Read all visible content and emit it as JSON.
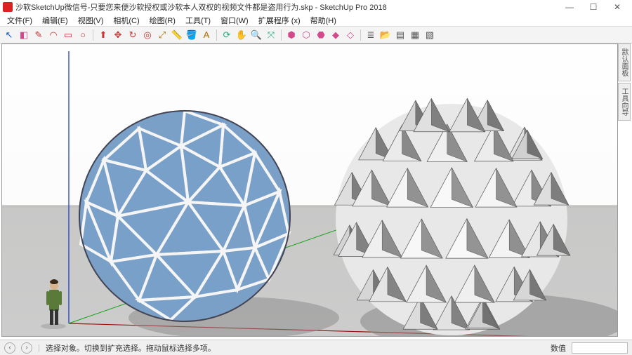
{
  "window": {
    "title": "沙软SketchUp微信号-只要您来便沙软授权或沙软本人双权的视频文件都是盗用行为.skp - SketchUp Pro 2018",
    "min": "—",
    "max": "☐",
    "close": "✕"
  },
  "menu": {
    "items": [
      "文件(F)",
      "编辑(E)",
      "视图(V)",
      "相机(C)",
      "绘图(R)",
      "工具(T)",
      "窗口(W)",
      "扩展程序 (x)",
      "帮助(H)"
    ]
  },
  "toolbar": {
    "icons": [
      {
        "name": "select-arrow-icon",
        "glyph": "↖",
        "color": "#1155cc"
      },
      {
        "name": "eraser-icon",
        "glyph": "◧",
        "color": "#d24a8a"
      },
      {
        "name": "line-icon",
        "glyph": "✎",
        "color": "#c33"
      },
      {
        "name": "arc-icon",
        "glyph": "◠",
        "color": "#c33"
      },
      {
        "name": "rect-icon",
        "glyph": "▭",
        "color": "#c33"
      },
      {
        "name": "circle-icon",
        "glyph": "○",
        "color": "#c33"
      },
      {
        "name": "sep",
        "glyph": "",
        "color": ""
      },
      {
        "name": "pushpull-icon",
        "glyph": "⬆",
        "color": "#c33"
      },
      {
        "name": "move-icon",
        "glyph": "✥",
        "color": "#c33"
      },
      {
        "name": "rotate-icon",
        "glyph": "↻",
        "color": "#c33"
      },
      {
        "name": "offset-icon",
        "glyph": "◎",
        "color": "#c33"
      },
      {
        "name": "scale-icon",
        "glyph": "⤢",
        "color": "#b36b00"
      },
      {
        "name": "tape-icon",
        "glyph": "📏",
        "color": "#b36b00"
      },
      {
        "name": "paint-icon",
        "glyph": "🪣",
        "color": "#b36b00"
      },
      {
        "name": "text-icon",
        "glyph": "A",
        "color": "#b36b00"
      },
      {
        "name": "sep",
        "glyph": "",
        "color": ""
      },
      {
        "name": "orbit-icon",
        "glyph": "⟳",
        "color": "#2a7"
      },
      {
        "name": "pan-icon",
        "glyph": "✋",
        "color": "#b36b00"
      },
      {
        "name": "zoom-icon",
        "glyph": "🔍",
        "color": "#2a7"
      },
      {
        "name": "zoom-extents-icon",
        "glyph": "⤧",
        "color": "#2a7"
      },
      {
        "name": "sep",
        "glyph": "",
        "color": ""
      },
      {
        "name": "warehouse-icon",
        "glyph": "⬢",
        "color": "#d24a8a"
      },
      {
        "name": "ext-icon",
        "glyph": "⬡",
        "color": "#d24a8a"
      },
      {
        "name": "ext2-icon",
        "glyph": "⬣",
        "color": "#d24a8a"
      },
      {
        "name": "ext3-icon",
        "glyph": "◆",
        "color": "#d24a8a"
      },
      {
        "name": "ext4-icon",
        "glyph": "◇",
        "color": "#d24a8a"
      },
      {
        "name": "sep",
        "glyph": "",
        "color": ""
      },
      {
        "name": "layer-icon",
        "glyph": "≣",
        "color": "#555"
      },
      {
        "name": "open-icon",
        "glyph": "📂",
        "color": "#555"
      },
      {
        "name": "outliner-icon",
        "glyph": "▤",
        "color": "#555"
      },
      {
        "name": "view-icon",
        "glyph": "▦",
        "color": "#555"
      },
      {
        "name": "view2-icon",
        "glyph": "▧",
        "color": "#555"
      }
    ]
  },
  "tray": {
    "tabs": [
      "默认面板",
      "工具向导"
    ]
  },
  "status": {
    "hint": "选择对象。切换到扩充选择。拖动鼠标选择多项。",
    "value_label": "数值"
  },
  "scene": {
    "figure_desc": "Human scale figure",
    "left_sphere": "Blue geodesic glass sphere",
    "right_sphere": "White spiky stellated sphere"
  }
}
